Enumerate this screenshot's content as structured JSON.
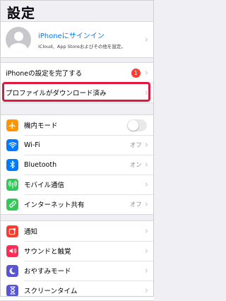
{
  "header": {
    "title": "設定"
  },
  "profile": {
    "signin_label": "iPhoneにサインイン",
    "subtitle": "iCloud、App Storeおよびその他を設定。",
    "avatar_icon": "person-silhouette-icon"
  },
  "setup": {
    "finish_label": "iPhoneの設定を完了する",
    "finish_badge": "1",
    "profile_label": "プロファイルがダウンロード済み"
  },
  "connectivity": {
    "airplane": {
      "label": "機内モード",
      "icon": "airplane-icon",
      "color": "#ff9500",
      "toggle_on": false
    },
    "wifi": {
      "label": "Wi-Fi",
      "value": "オフ",
      "icon": "wifi-icon",
      "color": "#007aff"
    },
    "bluetooth": {
      "label": "Bluetooth",
      "value": "オン",
      "icon": "bluetooth-icon",
      "color": "#007aff"
    },
    "cellular": {
      "label": "モバイル通信",
      "icon": "antenna-icon",
      "color": "#34c759"
    },
    "hotspot": {
      "label": "インターネット共有",
      "value": "オフ",
      "icon": "link-icon",
      "color": "#34c759"
    }
  },
  "notifications": {
    "notify": {
      "label": "通知",
      "icon": "notification-icon",
      "color": "#ff3b30"
    },
    "sound": {
      "label": "サウンドと触覚",
      "icon": "speaker-icon",
      "color": "#ff2d55"
    },
    "dnd": {
      "label": "おやすみモード",
      "icon": "moon-icon",
      "color": "#5856d6"
    },
    "screentime": {
      "label": "スクリーンタイム",
      "icon": "hourglass-icon",
      "color": "#5856d6"
    }
  },
  "chevron": "›",
  "highlight_color": "#e0173f"
}
